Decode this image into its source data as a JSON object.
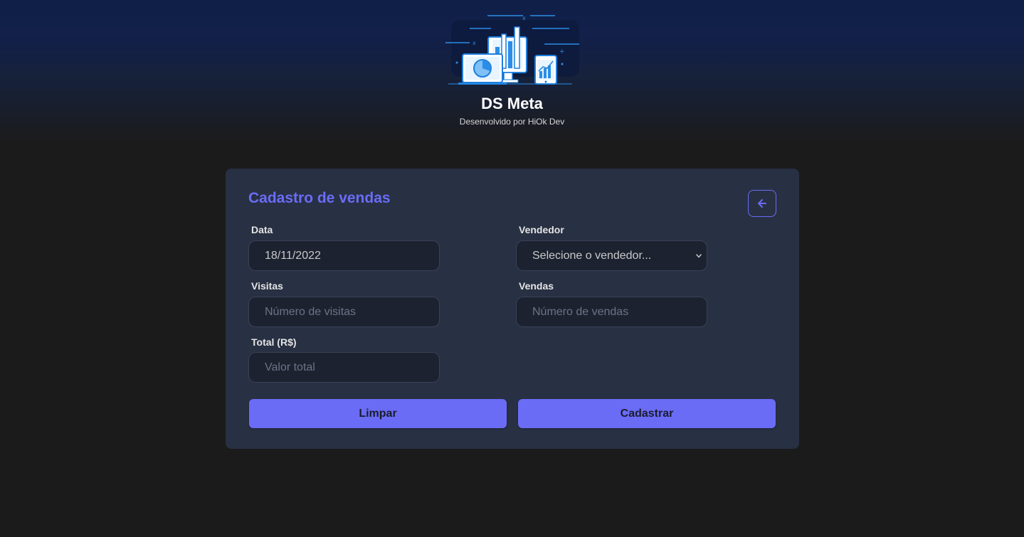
{
  "brand": {
    "title": "DS Meta",
    "subtitle": "Desenvolvido por HiOk Dev",
    "logo_icon": "sales-dashboard-devices-illustration"
  },
  "form": {
    "title": "Cadastro de vendas",
    "back_icon": "arrow-left-icon",
    "date": {
      "label": "Data",
      "value": "18/11/2022"
    },
    "seller": {
      "label": "Vendedor",
      "placeholder": "Selecione o vendedor..."
    },
    "visits": {
      "label": "Visitas",
      "placeholder": "Número de visitas"
    },
    "sales": {
      "label": "Vendas",
      "placeholder": "Número de vendas"
    },
    "total": {
      "label": "Total (R$)",
      "placeholder": "Valor total"
    },
    "clear_label": "Limpar",
    "submit_label": "Cadastrar"
  },
  "colors": {
    "accent": "#6a6cf6",
    "card_bg": "#283043",
    "page_bg": "#1b1b1c",
    "input_bg": "#1c2230"
  }
}
